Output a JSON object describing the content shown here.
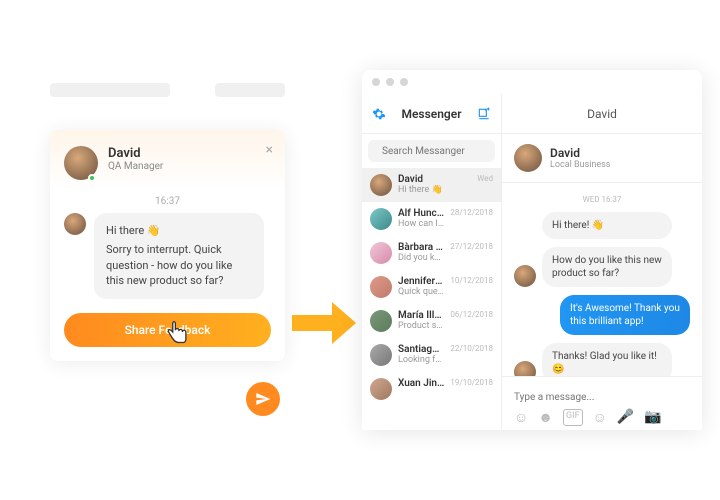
{
  "widget": {
    "name": "David",
    "role": "QA Manager",
    "time": "16:37",
    "greeting": "Hi there 👋",
    "message": "Sorry to interrupt. Quick question - how do you like this new product so far?",
    "button_label": "Share Feedback"
  },
  "messenger": {
    "title": "Messenger",
    "header_name": "David",
    "search_placeholder": "Search Messanger",
    "contacts": [
      {
        "name": "David",
        "preview": "Hi there 👋",
        "date": "Wed",
        "avatar": "av-david",
        "active": true
      },
      {
        "name": "Alf Huncoot",
        "preview": "How can I help you?",
        "date": "28/12/2018",
        "avatar": "av1"
      },
      {
        "name": "Bàrbara Co...",
        "preview": "Did you know that...",
        "date": "27/12/2018",
        "avatar": "av2"
      },
      {
        "name": "Jennifer Re...",
        "preview": "Quick question - how",
        "date": "10/12/2018",
        "avatar": "av4"
      },
      {
        "name": "María Illes...",
        "preview": "Product so far...",
        "date": "06/12/2018",
        "avatar": "av5"
      },
      {
        "name": "Santiago...",
        "preview": "Looking for a place...",
        "date": "22/10/2018",
        "avatar": "av6"
      },
      {
        "name": "Xuan Jingyi",
        "preview": "",
        "date": "19/10/2018",
        "avatar": "av7"
      }
    ],
    "chat": {
      "name": "David",
      "subtitle": "Local Business",
      "date_label": "WED 16:37",
      "messages": [
        {
          "side": "them",
          "text": "Hi there! 👋"
        },
        {
          "side": "them",
          "text": "How do you like this new product so far?"
        },
        {
          "side": "me",
          "text": "It's Awesome! Thank you this brilliant app!"
        },
        {
          "side": "them",
          "text": "Thanks! Glad you like it! 😊"
        }
      ],
      "input_placeholder": "Type a message..."
    }
  }
}
